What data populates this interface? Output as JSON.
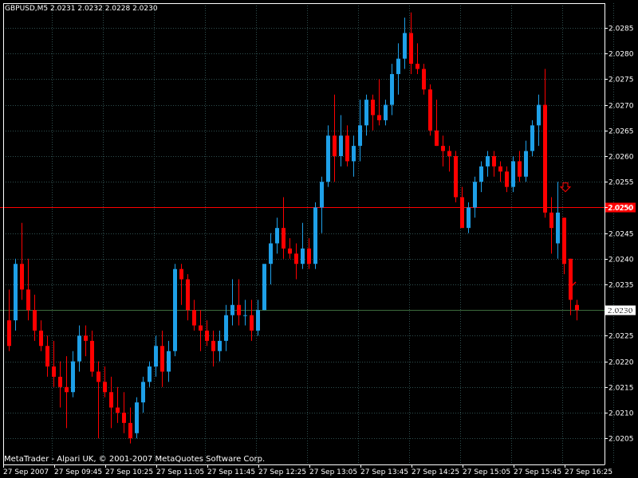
{
  "chart_header": "GBPUSD,M5  2.0231 2.0232 2.0228 2.0230",
  "footer": "MetaTrader - Alpari UK, © 2001-2007 MetaQuotes Software Corp.",
  "colors": {
    "background": "#000000",
    "bull": "#1ea0e8",
    "bear": "#ff0000",
    "grid": "#2f4f4f",
    "axis": "#ffffff",
    "red_line": "#ff0000",
    "price_line": "#3d6b3d",
    "text": "#ffffff"
  },
  "chart_data": {
    "type": "candlestick",
    "symbol": "GBPUSD",
    "timeframe": "M5",
    "ylim": [
      2.0203,
      2.0289
    ],
    "grid": true,
    "y_ticks": [
      "2.0285",
      "2.0280",
      "2.0275",
      "2.0270",
      "2.0265",
      "2.0260",
      "2.0255",
      "2.0250",
      "2.0245",
      "2.0240",
      "2.0235",
      "2.0230",
      "2.0225",
      "2.0220",
      "2.0215",
      "2.0210",
      "2.0205"
    ],
    "x_ticks": [
      "27 Sep 2007",
      "27 Sep 09:45",
      "27 Sep 10:25",
      "27 Sep 11:05",
      "27 Sep 11:45",
      "27 Sep 12:25",
      "27 Sep 13:05",
      "27 Sep 13:45",
      "27 Sep 14:25",
      "27 Sep 15:05",
      "27 Sep 15:45",
      "27 Sep 16:25"
    ],
    "horizontal_lines": [
      {
        "value": 2.025,
        "label": "2.0250",
        "color": "#ff0000"
      },
      {
        "value": 2.023,
        "label": "2.0230",
        "color": "#3d6b3d"
      }
    ],
    "arrows": [
      {
        "index": 86,
        "price": 2.0254,
        "direction": "down"
      },
      {
        "index": 87,
        "price": 2.0235,
        "direction": "check"
      }
    ],
    "candles": [
      [
        2.0228,
        2.0234,
        2.0222,
        2.0223
      ],
      [
        2.0228,
        2.024,
        2.0226,
        2.0239
      ],
      [
        2.0239,
        2.0247,
        2.0232,
        2.0234
      ],
      [
        2.0234,
        2.024,
        2.0228,
        2.023
      ],
      [
        2.023,
        2.0233,
        2.0224,
        2.0226
      ],
      [
        2.0226,
        2.0228,
        2.0222,
        2.0223
      ],
      [
        2.0223,
        2.0225,
        2.0217,
        2.0219
      ],
      [
        2.0219,
        2.0224,
        2.0215,
        2.0217
      ],
      [
        2.0217,
        2.022,
        2.0211,
        2.0215
      ],
      [
        2.0215,
        2.0221,
        2.0207,
        2.0214
      ],
      [
        2.0214,
        2.0222,
        2.0213,
        2.022
      ],
      [
        2.022,
        2.0227,
        2.0218,
        2.0225
      ],
      [
        2.0225,
        2.0227,
        2.0221,
        2.0224
      ],
      [
        2.0224,
        2.0226,
        2.0217,
        2.0218
      ],
      [
        2.0218,
        2.022,
        2.0205,
        2.0216
      ],
      [
        2.0216,
        2.0219,
        2.0213,
        2.0214
      ],
      [
        2.0214,
        2.0217,
        2.0207,
        2.0211
      ],
      [
        2.0211,
        2.0215,
        2.0208,
        2.021
      ],
      [
        2.021,
        2.0214,
        2.0206,
        2.0208
      ],
      [
        2.0208,
        2.0211,
        2.0204,
        2.0205
      ],
      [
        2.0206,
        2.0213,
        2.0205,
        2.0212
      ],
      [
        2.0212,
        2.0217,
        2.021,
        2.0216
      ],
      [
        2.0216,
        2.022,
        2.0215,
        2.0219
      ],
      [
        2.0219,
        2.0225,
        2.0217,
        2.0223
      ],
      [
        2.0223,
        2.0226,
        2.0215,
        2.0218
      ],
      [
        2.0218,
        2.0224,
        2.0216,
        2.0222
      ],
      [
        2.0222,
        2.0239,
        2.0221,
        2.0238
      ],
      [
        2.0238,
        2.0239,
        2.0231,
        2.0236
      ],
      [
        2.0236,
        2.0237,
        2.0228,
        2.023
      ],
      [
        2.023,
        2.0232,
        2.0226,
        2.0227
      ],
      [
        2.0227,
        2.023,
        2.0222,
        2.0226
      ],
      [
        2.0226,
        2.0228,
        2.0223,
        2.0224
      ],
      [
        2.0224,
        2.0226,
        2.0219,
        2.0222
      ],
      [
        2.0222,
        2.0226,
        2.022,
        2.0224
      ],
      [
        2.0224,
        2.0231,
        2.0222,
        2.0229
      ],
      [
        2.0229,
        2.0236,
        2.0227,
        2.0231
      ],
      [
        2.0231,
        2.0236,
        2.0227,
        2.0229
      ],
      [
        2.0229,
        2.0232,
        2.0227,
        2.0229
      ],
      [
        2.0229,
        2.0232,
        2.0224,
        2.0226
      ],
      [
        2.0226,
        2.0232,
        2.0225,
        2.023
      ],
      [
        2.023,
        2.0238,
        2.023,
        2.0239
      ],
      [
        2.0239,
        2.0245,
        2.0235,
        2.0243
      ],
      [
        2.0243,
        2.0248,
        2.0241,
        2.0246
      ],
      [
        2.0246,
        2.0252,
        2.024,
        2.0242
      ],
      [
        2.0242,
        2.0244,
        2.024,
        2.0241
      ],
      [
        2.0241,
        2.0243,
        2.0236,
        2.0239
      ],
      [
        2.0239,
        2.0247,
        2.0238,
        2.0242
      ],
      [
        2.0242,
        2.0244,
        2.0238,
        2.0239
      ],
      [
        2.0239,
        2.0251,
        2.0238,
        2.025
      ],
      [
        2.025,
        2.0256,
        2.0245,
        2.0255
      ],
      [
        2.0255,
        2.0266,
        2.0254,
        2.0264
      ],
      [
        2.0264,
        2.0272,
        2.0255,
        2.026
      ],
      [
        2.026,
        2.0268,
        2.0258,
        2.0264
      ],
      [
        2.0264,
        2.0266,
        2.0258,
        2.0259
      ],
      [
        2.0259,
        2.0264,
        2.0256,
        2.0262
      ],
      [
        2.0262,
        2.0271,
        2.0259,
        2.0266
      ],
      [
        2.0266,
        2.0272,
        2.0264,
        2.0271
      ],
      [
        2.0271,
        2.0272,
        2.0265,
        2.0268
      ],
      [
        2.0268,
        2.0275,
        2.0266,
        2.0267
      ],
      [
        2.0267,
        2.0271,
        2.0266,
        2.027
      ],
      [
        2.027,
        2.0278,
        2.0268,
        2.0276
      ],
      [
        2.0276,
        2.0282,
        2.0272,
        2.0279
      ],
      [
        2.0279,
        2.0287,
        2.0277,
        2.0284
      ],
      [
        2.0284,
        2.0288,
        2.0276,
        2.0278
      ],
      [
        2.0278,
        2.0282,
        2.0276,
        2.0277
      ],
      [
        2.0277,
        2.0278,
        2.0272,
        2.0273
      ],
      [
        2.0273,
        2.0274,
        2.0264,
        2.0265
      ],
      [
        2.0265,
        2.0271,
        2.0262,
        2.0262
      ],
      [
        2.0262,
        2.0264,
        2.0258,
        2.0261
      ],
      [
        2.0261,
        2.0262,
        2.0257,
        2.026
      ],
      [
        2.026,
        2.0261,
        2.0251,
        2.0252
      ],
      [
        2.0252,
        2.0254,
        2.0246,
        2.0246
      ],
      [
        2.0246,
        2.0251,
        2.0245,
        2.025
      ],
      [
        2.025,
        2.0256,
        2.0248,
        2.0255
      ],
      [
        2.0255,
        2.0259,
        2.0253,
        2.0258
      ],
      [
        2.0258,
        2.0261,
        2.0256,
        2.026
      ],
      [
        2.026,
        2.0261,
        2.0256,
        2.0258
      ],
      [
        2.0258,
        2.0259,
        2.0255,
        2.0257
      ],
      [
        2.0257,
        2.0258,
        2.0253,
        2.0254
      ],
      [
        2.0254,
        2.026,
        2.0253,
        2.0259
      ],
      [
        2.0259,
        2.0261,
        2.0255,
        2.0256
      ],
      [
        2.0256,
        2.0263,
        2.0255,
        2.0261
      ],
      [
        2.0261,
        2.0267,
        2.026,
        2.0266
      ],
      [
        2.0266,
        2.0272,
        2.0262,
        2.027
      ],
      [
        2.027,
        2.0277,
        2.0248,
        2.0249
      ],
      [
        2.0249,
        2.0252,
        2.0241,
        2.0246
      ],
      [
        2.0243,
        2.0255,
        2.024,
        2.0249
      ],
      [
        2.0248,
        2.0248,
        2.0237,
        2.0239
      ],
      [
        2.024,
        2.024,
        2.0229,
        2.0232
      ],
      [
        2.0231,
        2.0232,
        2.0228,
        2.023
      ]
    ]
  }
}
